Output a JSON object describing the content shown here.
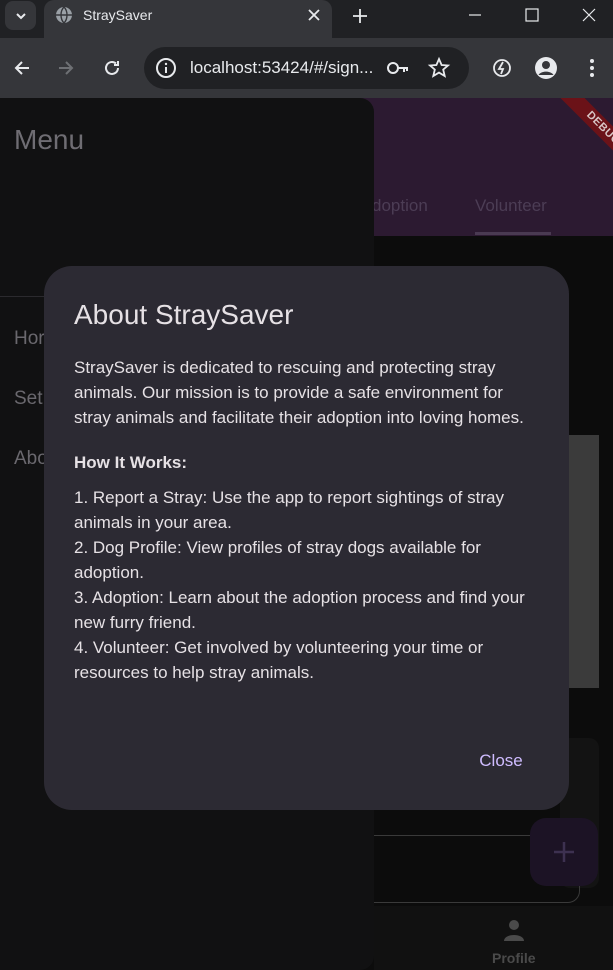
{
  "browser": {
    "tab_title": "StraySaver",
    "url": "localhost:53424/#/sign...",
    "icons": [
      "chevron-down-icon",
      "globe-icon",
      "close-icon",
      "plus-icon",
      "minimize-icon",
      "maximize-icon",
      "close-window-icon",
      "back-arrow-icon",
      "forward-arrow-icon",
      "reload-icon",
      "site-info-icon",
      "key-icon",
      "star-icon",
      "extension-icon",
      "profile-icon",
      "kebab-menu-icon"
    ]
  },
  "app": {
    "debug_banner": "DEBUG",
    "appbar_tabs": [
      "doption",
      "Volunteer"
    ],
    "bottom_nav": {
      "profile_label": "Profile"
    },
    "fab_icon": "plus-icon"
  },
  "drawer": {
    "title": "Menu",
    "items": [
      "Hor",
      "Set",
      "Abo"
    ]
  },
  "dialog": {
    "title": "About StraySaver",
    "intro": "StraySaver is dedicated to rescuing and protecting stray animals. Our mission is to provide a safe environment for stray animals and facilitate their adoption into loving homes.",
    "how_heading": "How It Works:",
    "steps": [
      "1. Report a Stray: Use the app to report sightings of stray animals in your area.",
      "2. Dog Profile: View profiles of stray dogs available for adoption.",
      "3. Adoption: Learn about the adoption process and find your new furry friend.",
      "4. Volunteer: Get involved by volunteering your time or resources to help stray animals."
    ],
    "close_label": "Close"
  },
  "colors": {
    "dialog_bg": "#2c2a33",
    "accent": "#cfbcff",
    "appbar_purple": "#2c1a31",
    "debug_red": "#6b1218"
  }
}
